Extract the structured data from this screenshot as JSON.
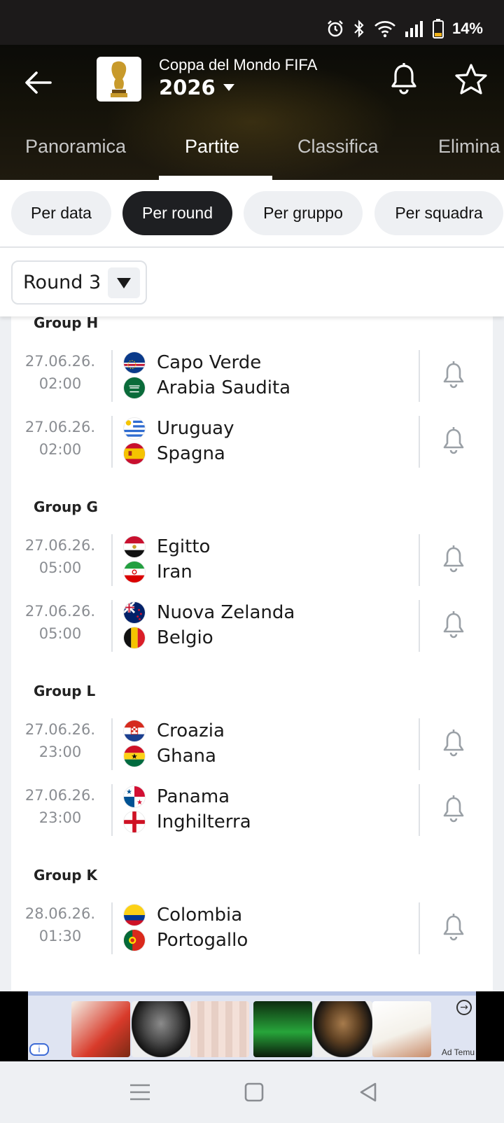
{
  "status_bar": {
    "battery": "14%"
  },
  "header": {
    "competition": "Coppa del Mondo FIFA",
    "season": "2026",
    "tabs": [
      {
        "label": "Panoramica",
        "active": false
      },
      {
        "label": "Partite",
        "active": true
      },
      {
        "label": "Classifica",
        "active": false
      },
      {
        "label": "Elimina",
        "active": false
      }
    ]
  },
  "filters": {
    "chips": [
      {
        "label": "Per data",
        "active": false
      },
      {
        "label": "Per round",
        "active": true
      },
      {
        "label": "Per gruppo",
        "active": false
      },
      {
        "label": "Per squadra",
        "active": false
      }
    ],
    "round_select": "Round 3"
  },
  "groups": [
    {
      "title": "Group H",
      "matches": [
        {
          "date": "27.06.26.",
          "time": "02:00",
          "home": "Capo Verde",
          "away": "Arabia Saudita"
        },
        {
          "date": "27.06.26.",
          "time": "02:00",
          "home": "Uruguay",
          "away": "Spagna"
        }
      ]
    },
    {
      "title": "Group G",
      "matches": [
        {
          "date": "27.06.26.",
          "time": "05:00",
          "home": "Egitto",
          "away": "Iran"
        },
        {
          "date": "27.06.26.",
          "time": "05:00",
          "home": "Nuova Zelanda",
          "away": "Belgio"
        }
      ]
    },
    {
      "title": "Group L",
      "matches": [
        {
          "date": "27.06.26.",
          "time": "23:00",
          "home": "Croazia",
          "away": "Ghana"
        },
        {
          "date": "27.06.26.",
          "time": "23:00",
          "home": "Panama",
          "away": "Inghilterra"
        }
      ]
    },
    {
      "title": "Group K",
      "matches": [
        {
          "date": "28.06.26.",
          "time": "01:30",
          "home": "Colombia",
          "away": "Portogallo"
        }
      ]
    }
  ],
  "ad": {
    "label": "Ad Temu",
    "info": "i"
  },
  "icons": {
    "back": "arrow-left-icon",
    "notifications": "bell-icon",
    "favorite": "star-icon",
    "dropdown": "caret-down-icon"
  }
}
